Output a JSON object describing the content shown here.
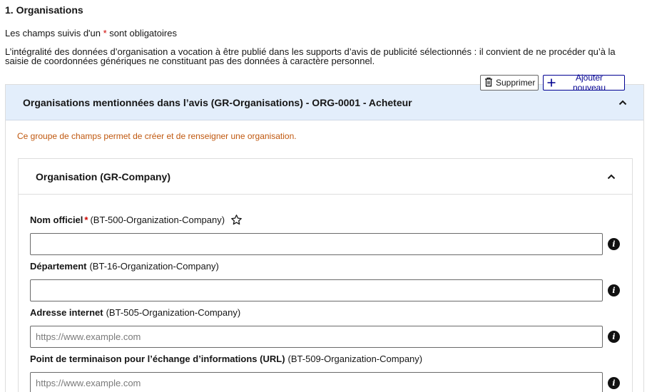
{
  "section": {
    "title": "1. Organisations",
    "required_prefix": "Les champs suivis d'un ",
    "required_star": "*",
    "required_suffix": " sont obligatoires",
    "info": "L’intégralité des données d’organisation a vocation à être publié dans les supports d’avis de publicité sélectionnés : il convient de ne procéder qu’à la saisie de coordonnées génériques ne constituant pas des données à caractère personnel."
  },
  "toolbar": {
    "delete_label": "Supprimer",
    "delete_icon": "trash-icon",
    "add_label": "Ajouter nouveau",
    "add_icon": "plus-icon"
  },
  "group": {
    "title": "Organisations mentionnées dans l’avis (GR-Organisations) - ORG-0001 - Acheteur",
    "description": "Ce groupe de champs permet de créer et de renseigner une organisation.",
    "subgroup": {
      "title": "Organisation (GR-Company)",
      "fields": [
        {
          "label": "Nom officiel",
          "required": "*",
          "code": "(BT-500-Organization-Company)",
          "value": "",
          "placeholder": ""
        },
        {
          "label": "Département",
          "code": "(BT-16-Organization-Company)",
          "value": "",
          "placeholder": ""
        },
        {
          "label": "Adresse internet",
          "code": "(BT-505-Organization-Company)",
          "value": "",
          "placeholder": "https://www.example.com"
        },
        {
          "label": "Point de terminaison pour l’échange d’informations (URL)",
          "code": "(BT-509-Organization-Company)",
          "value": "",
          "placeholder": "https://www.example.com"
        }
      ]
    }
  },
  "colors": {
    "accent": "#000091",
    "required": "#ce0500",
    "header_bg": "#e3eefb",
    "description": "#c0580f"
  }
}
